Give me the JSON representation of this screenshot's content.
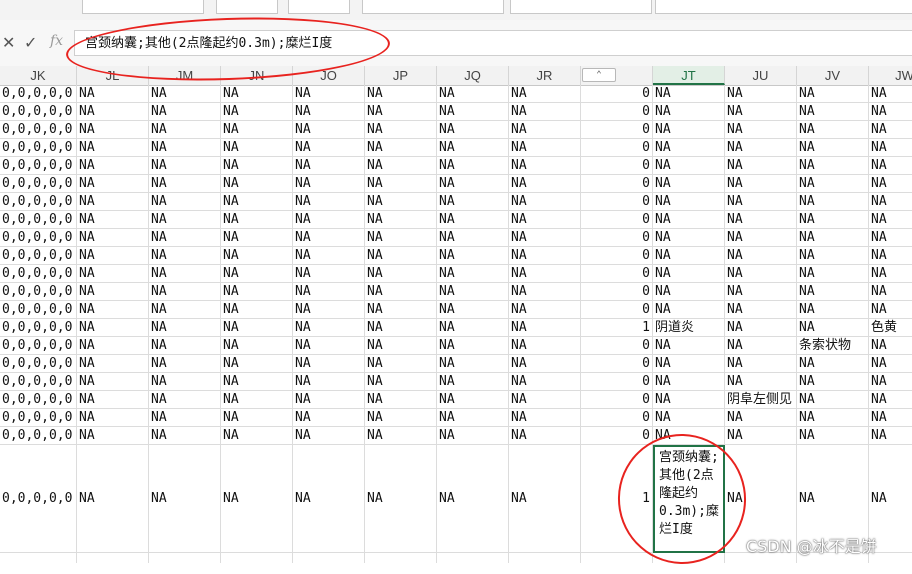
{
  "formula_bar": {
    "cancel_icon": "close-icon",
    "confirm_icon": "check-icon",
    "fx_label": "fx",
    "value": "宫颈纳囊;其他(2点隆起约0.3m);糜烂I度"
  },
  "columns": [
    "JK",
    "JL",
    "JM",
    "JN",
    "JO",
    "JP",
    "JQ",
    "JR",
    "",
    "JT",
    "JU",
    "JV",
    "JW"
  ],
  "selected_column": "JT",
  "rows": [
    [
      "0,0,0,0,0",
      "NA",
      "NA",
      "NA",
      "NA",
      "NA",
      "NA",
      "NA",
      "0",
      "NA",
      "NA",
      "NA",
      "NA"
    ],
    [
      "0,0,0,0,0",
      "NA",
      "NA",
      "NA",
      "NA",
      "NA",
      "NA",
      "NA",
      "0",
      "NA",
      "NA",
      "NA",
      "NA"
    ],
    [
      "0,0,0,0,0",
      "NA",
      "NA",
      "NA",
      "NA",
      "NA",
      "NA",
      "NA",
      "0",
      "NA",
      "NA",
      "NA",
      "NA"
    ],
    [
      "0,0,0,0,0",
      "NA",
      "NA",
      "NA",
      "NA",
      "NA",
      "NA",
      "NA",
      "0",
      "NA",
      "NA",
      "NA",
      "NA"
    ],
    [
      "0,0,0,0,0",
      "NA",
      "NA",
      "NA",
      "NA",
      "NA",
      "NA",
      "NA",
      "0",
      "NA",
      "NA",
      "NA",
      "NA"
    ],
    [
      "0,0,0,0,0",
      "NA",
      "NA",
      "NA",
      "NA",
      "NA",
      "NA",
      "NA",
      "0",
      "NA",
      "NA",
      "NA",
      "NA"
    ],
    [
      "0,0,0,0,0",
      "NA",
      "NA",
      "NA",
      "NA",
      "NA",
      "NA",
      "NA",
      "0",
      "NA",
      "NA",
      "NA",
      "NA"
    ],
    [
      "0,0,0,0,0",
      "NA",
      "NA",
      "NA",
      "NA",
      "NA",
      "NA",
      "NA",
      "0",
      "NA",
      "NA",
      "NA",
      "NA"
    ],
    [
      "0,0,0,0,0",
      "NA",
      "NA",
      "NA",
      "NA",
      "NA",
      "NA",
      "NA",
      "0",
      "NA",
      "NA",
      "NA",
      "NA"
    ],
    [
      "0,0,0,0,0",
      "NA",
      "NA",
      "NA",
      "NA",
      "NA",
      "NA",
      "NA",
      "0",
      "NA",
      "NA",
      "NA",
      "NA"
    ],
    [
      "0,0,0,0,0",
      "NA",
      "NA",
      "NA",
      "NA",
      "NA",
      "NA",
      "NA",
      "0",
      "NA",
      "NA",
      "NA",
      "NA"
    ],
    [
      "0,0,0,0,0",
      "NA",
      "NA",
      "NA",
      "NA",
      "NA",
      "NA",
      "NA",
      "0",
      "NA",
      "NA",
      "NA",
      "NA"
    ],
    [
      "0,0,0,0,0",
      "NA",
      "NA",
      "NA",
      "NA",
      "NA",
      "NA",
      "NA",
      "0",
      "NA",
      "NA",
      "NA",
      "NA"
    ],
    [
      "0,0,0,0,0",
      "NA",
      "NA",
      "NA",
      "NA",
      "NA",
      "NA",
      "NA",
      "1",
      "阴道炎",
      "NA",
      "NA",
      "色黄"
    ],
    [
      "0,0,0,0,0",
      "NA",
      "NA",
      "NA",
      "NA",
      "NA",
      "NA",
      "NA",
      "0",
      "NA",
      "NA",
      "条索状物",
      "NA"
    ],
    [
      "0,0,0,0,0",
      "NA",
      "NA",
      "NA",
      "NA",
      "NA",
      "NA",
      "NA",
      "0",
      "NA",
      "NA",
      "NA",
      "NA"
    ],
    [
      "0,0,0,0,0",
      "NA",
      "NA",
      "NA",
      "NA",
      "NA",
      "NA",
      "NA",
      "0",
      "NA",
      "NA",
      "NA",
      "NA"
    ],
    [
      "0,0,0,0,0",
      "NA",
      "NA",
      "NA",
      "NA",
      "NA",
      "NA",
      "NA",
      "0",
      "NA",
      "阴阜左侧见",
      "NA",
      "NA"
    ],
    [
      "0,0,0,0,0",
      "NA",
      "NA",
      "NA",
      "NA",
      "NA",
      "NA",
      "NA",
      "0",
      "NA",
      "NA",
      "NA",
      "NA"
    ],
    [
      "0,0,0,0,0",
      "NA",
      "NA",
      "NA",
      "NA",
      "NA",
      "NA",
      "NA",
      "0",
      "NA",
      "NA",
      "NA",
      "NA"
    ],
    [
      "0,0,0,0,0",
      "NA",
      "NA",
      "NA",
      "NA",
      "NA",
      "NA",
      "NA",
      "1",
      "宫颈纳囊;其他(2点隆起约0.3m);糜烂I度",
      "NA",
      "NA",
      "NA"
    ]
  ],
  "watermark": "CSDN @冰不是饼",
  "annotation_color": "#e8231f",
  "accent_color": "#217346"
}
